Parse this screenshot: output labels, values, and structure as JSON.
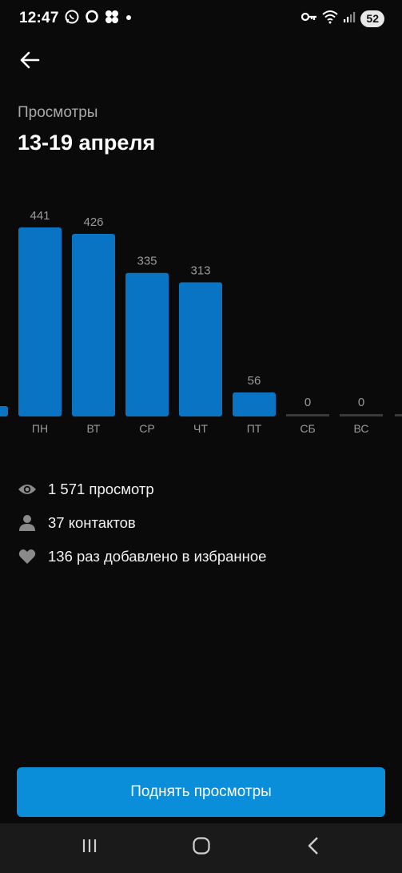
{
  "status_bar": {
    "time": "12:47",
    "left_icons": [
      "whatsapp-icon",
      "chat-bubble-icon",
      "dots-cluster-icon",
      "notification-dot-icon"
    ],
    "right_icons": [
      "vpn-key-icon",
      "wifi-icon",
      "signal-icon"
    ],
    "battery": "52"
  },
  "header": {
    "back_icon": "arrow-left-icon",
    "subtitle": "Просмотры",
    "title": "13-19 апреля"
  },
  "chart_data": {
    "type": "bar",
    "categories": [
      "ПН",
      "ВТ",
      "СР",
      "ЧТ",
      "ПТ",
      "СБ",
      "ВС"
    ],
    "values": [
      441,
      426,
      335,
      313,
      56,
      0,
      0
    ],
    "bar_color": "#0a74c4",
    "zero_color": "#3a3a3a",
    "label_color": "#9a9a9a"
  },
  "stats": [
    {
      "icon": "eye-icon",
      "text": "1 571 просмотр"
    },
    {
      "icon": "person-icon",
      "text": "37 контактов"
    },
    {
      "icon": "heart-icon",
      "text": "136 раз добавлено в избранное"
    }
  ],
  "cta": {
    "label": "Поднять просмотры",
    "color": "#0a8ed9"
  },
  "nav": {
    "icons": [
      "recent-apps-icon",
      "home-icon",
      "back-icon"
    ]
  }
}
